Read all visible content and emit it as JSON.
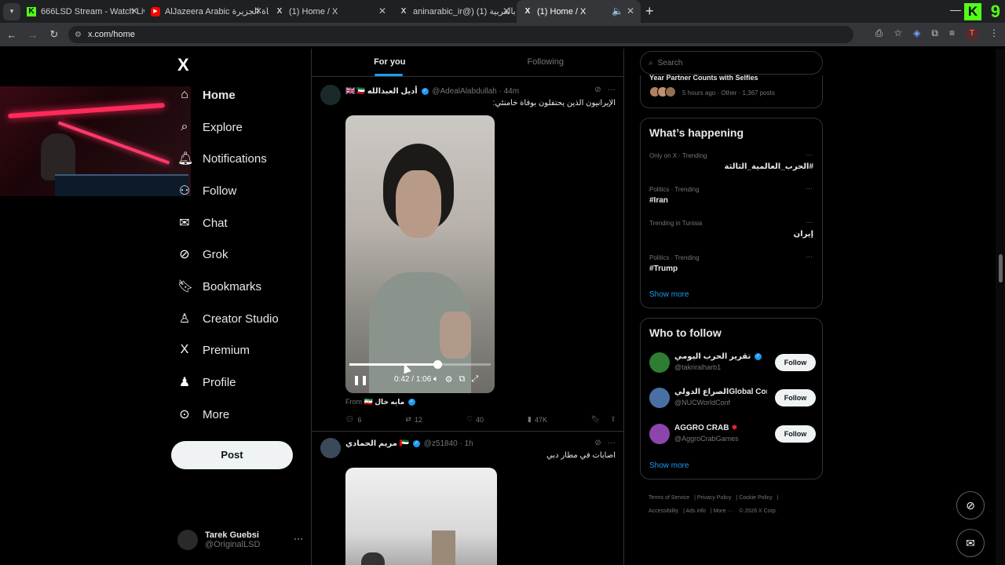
{
  "browser": {
    "tabs": [
      {
        "label": "666LSD Stream - Watch Live on",
        "favicon": "kick-icon"
      },
      {
        "label": "AlJazeera Arabic قناة الجزيرة - Y",
        "favicon": "youtube-icon"
      },
      {
        "label": "(1) Home / X",
        "favicon": "x-icon"
      },
      {
        "label": "aninarabic_ir@) إيران بالعربية (1)",
        "favicon": "x-icon"
      },
      {
        "label": "(1) Home / X",
        "favicon": "x-icon",
        "active": true
      }
    ],
    "url": "x.com/home",
    "kick_number": "9",
    "profile_letter": "T"
  },
  "sidebar": {
    "nav": [
      {
        "label": "Home",
        "icon": "home-icon"
      },
      {
        "label": "Explore",
        "icon": "search-icon"
      },
      {
        "label": "Notifications",
        "icon": "bell-icon"
      },
      {
        "label": "Follow",
        "icon": "people-icon"
      },
      {
        "label": "Chat",
        "icon": "mail-icon"
      },
      {
        "label": "Grok",
        "icon": "grok-icon"
      },
      {
        "label": "Bookmarks",
        "icon": "bookmark-icon"
      },
      {
        "label": "Creator Studio",
        "icon": "creator-icon"
      },
      {
        "label": "Premium",
        "icon": "x-icon"
      },
      {
        "label": "Profile",
        "icon": "person-icon"
      },
      {
        "label": "More",
        "icon": "more-icon"
      }
    ],
    "post_label": "Post",
    "account": {
      "name": "Tarek Guebsi",
      "handle": "@OriginalLSD"
    }
  },
  "timeline": {
    "tabs": [
      "For you",
      "Following"
    ],
    "tweets": [
      {
        "name": "أديل العبدالله",
        "handle": "@AdealAlabdullah",
        "time": "44m",
        "text": "الإيرانيون الذين يحتفلون بوفاة خامنئي:",
        "video": {
          "current": "0:42",
          "duration": "1:06",
          "progress_fraction": 0.62
        },
        "from_label": "From",
        "from_source": "مايه خال",
        "stats": {
          "replies": "6",
          "reposts": "12",
          "likes": "40",
          "views": "47K"
        }
      },
      {
        "name": "مريم الحمادي",
        "handle": "@z51840",
        "time": "1h",
        "text": "اصابات في مطار دبي"
      }
    ]
  },
  "right": {
    "search_placeholder": "Search",
    "top_trend": {
      "title": "Year Partner Counts with Selfies",
      "meta": "5 hours ago · Other · 1,367 posts"
    },
    "whats_happening": {
      "title": "What’s happening",
      "trends": [
        {
          "meta": "Only on X · Trending",
          "name": "#الحرب_العالمية_الثالثة",
          "rtl": true
        },
        {
          "meta": "Politics · Trending",
          "name": "#Iran",
          "rtl": false
        },
        {
          "meta": "Trending in Tunisia",
          "name": "إيران",
          "rtl": true
        },
        {
          "meta": "Politics · Trending",
          "name": "#Trump",
          "rtl": false
        }
      ],
      "show_more": "Show more"
    },
    "who_to_follow": {
      "title": "Who to follow",
      "accounts": [
        {
          "name": "تقرير الحرب اليومي",
          "handle": "@takriralharb1",
          "button": "Follow",
          "avatar_color": "#2e7d32"
        },
        {
          "name": "الصراع الدوليGlobal Con...",
          "handle": "@NUCWorldConf",
          "button": "Follow",
          "avatar_color": "#4a6fa5"
        },
        {
          "name": "AGGRO CRAB",
          "handle": "@AggroCrabGames",
          "button": "Follow",
          "avatar_color": "#8e44ad"
        }
      ],
      "show_more": "Show more"
    },
    "footer": [
      "Terms of Service",
      "Privacy Policy",
      "Cookie Policy",
      "Accessibility",
      "Ads info",
      "More ···",
      "© 2026 X Corp."
    ]
  },
  "colors": {
    "accent": "#1d9bf0",
    "bg": "#000000",
    "border": "#2f3336",
    "muted": "#71767b",
    "kick_green": "#53fc18"
  }
}
